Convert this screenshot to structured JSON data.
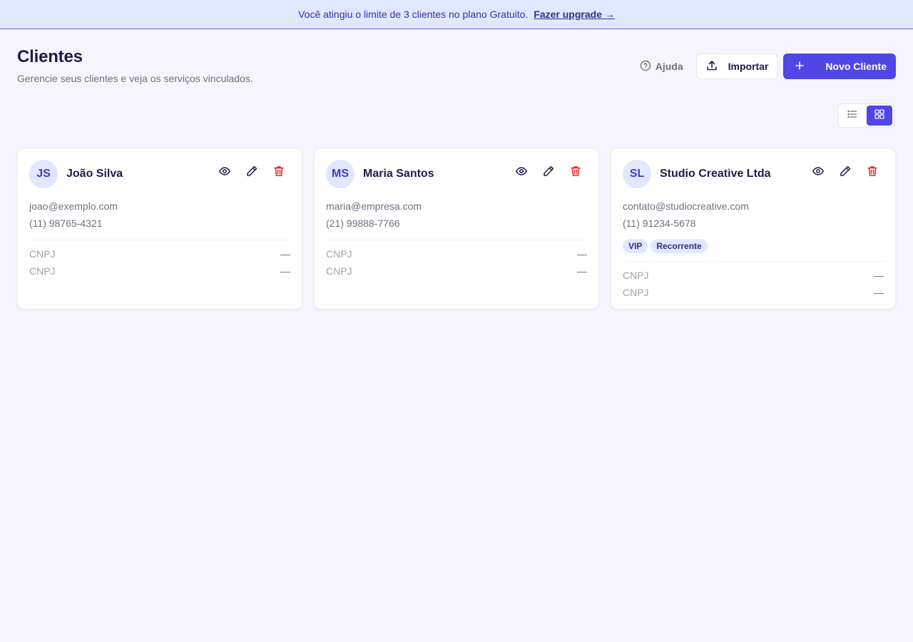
{
  "banner": {
    "message": "Você atingiu o limite de 3 clientes no plano Gratuito.",
    "link": "Fazer upgrade →"
  },
  "header": {
    "title": "Clientes",
    "subtitle": "Gerencie seus clientes e veja os serviços vinculados.",
    "help_label": "Ajuda",
    "import_label": "Importar",
    "new_label": "Novo Cliente"
  },
  "view": {
    "options": [
      "list",
      "grid"
    ],
    "selected": "grid"
  },
  "colors": {
    "accent": "#4f46e5",
    "banner_bg": "#e0e7ff",
    "delete": "#dc2626",
    "background": "#f6f5fd"
  },
  "clients": [
    {
      "initials": "JS",
      "name": "João Silva",
      "email": "joao@exemplo.com",
      "phone": "(11) 98765-4321",
      "tags": [],
      "meta": [
        {
          "label": "CNPJ",
          "value": "—"
        },
        {
          "label": "CNPJ",
          "value": "—"
        }
      ]
    },
    {
      "initials": "MS",
      "name": "Maria Santos",
      "email": "maria@empresa.com",
      "phone": "(21) 99888-7766",
      "tags": [],
      "meta": [
        {
          "label": "CNPJ",
          "value": "—"
        },
        {
          "label": "CNPJ",
          "value": "—"
        }
      ]
    },
    {
      "initials": "SL",
      "name": "Studio Creative Ltda",
      "email": "contato@studiocreative.com",
      "phone": "(11) 91234-5678",
      "tags": [
        "VIP",
        "Recorrente"
      ],
      "meta": [
        {
          "label": "CNPJ",
          "value": "—"
        },
        {
          "label": "CNPJ",
          "value": "—"
        }
      ]
    }
  ]
}
